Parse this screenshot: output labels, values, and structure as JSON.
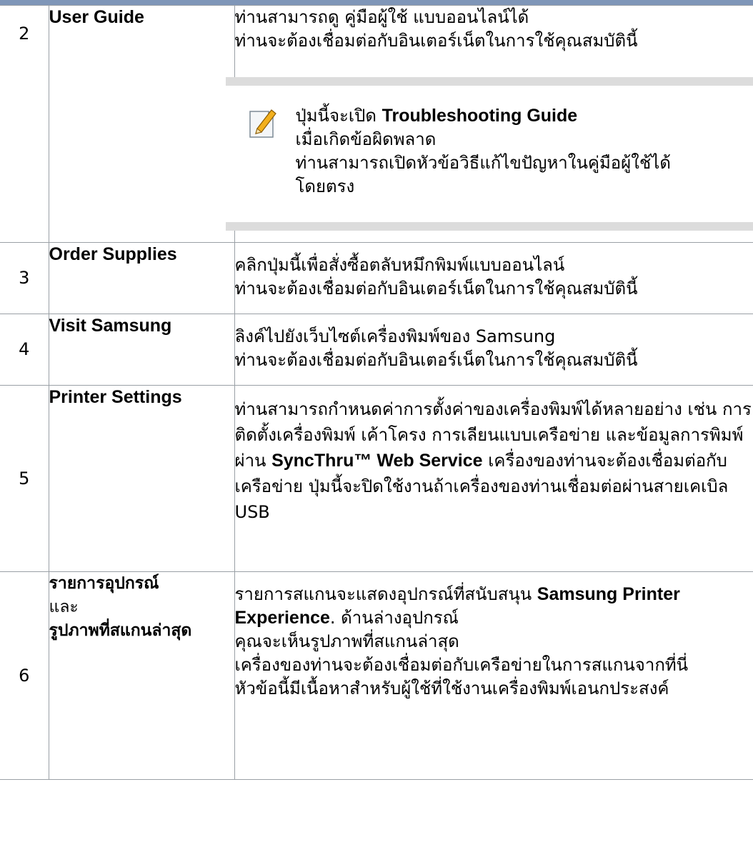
{
  "rows": [
    {
      "num": "2",
      "name": "User Guide",
      "lines": [
        "ท่านสามารถดู คู่มือผู้ใช้ แบบออนไลน์ได้",
        "ท่านจะต้องเชื่อมต่อกับอินเตอร์เน็ตในการใช้คุณสมบัตินี้"
      ],
      "note": {
        "prefix": "ปุ่มนี้จะเปิด ",
        "bold": "Troubleshooting Guide",
        "lines": [
          "เมื่อเกิดข้อผิดพลาด",
          "ท่านสามารถเปิดหัวข้อวิธีแก้ไขปัญหาในคู่มือผู้ใช้ได้โดยตรง"
        ]
      }
    },
    {
      "num": "3",
      "name": "Order Supplies",
      "lines": [
        "คลิกปุ่มนี้เพื่อสั่งซื้อตลับหมึกพิมพ์แบบออนไลน์",
        "ท่านจะต้องเชื่อมต่อกับอินเตอร์เน็ตในการใช้คุณสมบัตินี้"
      ]
    },
    {
      "num": "4",
      "name": "Visit Samsung",
      "lines": [
        "ลิงค์ไปยังเว็บไซต์เครื่องพิมพ์ของ Samsung",
        "ท่านจะต้องเชื่อมต่อกับอินเตอร์เน็ตในการใช้คุณสมบัตินี้"
      ]
    },
    {
      "num": "5",
      "name": "Printer Settings",
      "p1": "ท่านสามารถกำหนดค่าการตั้งค่าของเครื่องพิมพ์ได้หลายอย่าง เช่น การติดตั้งเครื่องพิมพ์ เค้าโครง การเลียนแบบเครือข่าย และข้อมูลการพิมพ์ผ่าน ",
      "bold": "SyncThru™ Web Service",
      "p2": " เครื่องของท่านจะต้องเชื่อมต่อกับเครือข่าย ปุ่มนี้จะปิดใช้งานถ้าเครื่องของท่านเชื่อมต่อผ่านสายเคเบิล USB"
    },
    {
      "num": "6",
      "name_a": "รายการอุปกรณ์",
      "name_and": "และ",
      "name_b": "รูปภาพที่สแกนล่าสุด",
      "p1": "รายการสแกนจะแสดงอุปกรณ์ที่สนับสนุน ",
      "bold": "Samsung Printer Experience",
      "p2": ". ด้านล่างอุปกรณ์",
      "lines": [
        "คุณจะเห็นรูปภาพที่สแกนล่าสุด",
        "เครื่องของท่านจะต้องเชื่อมต่อกับเครือข่ายในการสแกนจากที่นี่",
        "หัวข้อนี้มีเนื้อหาสำหรับผู้ใช้ที่ใช้งานเครื่องพิมพ์เอนกประสงค์"
      ]
    }
  ]
}
